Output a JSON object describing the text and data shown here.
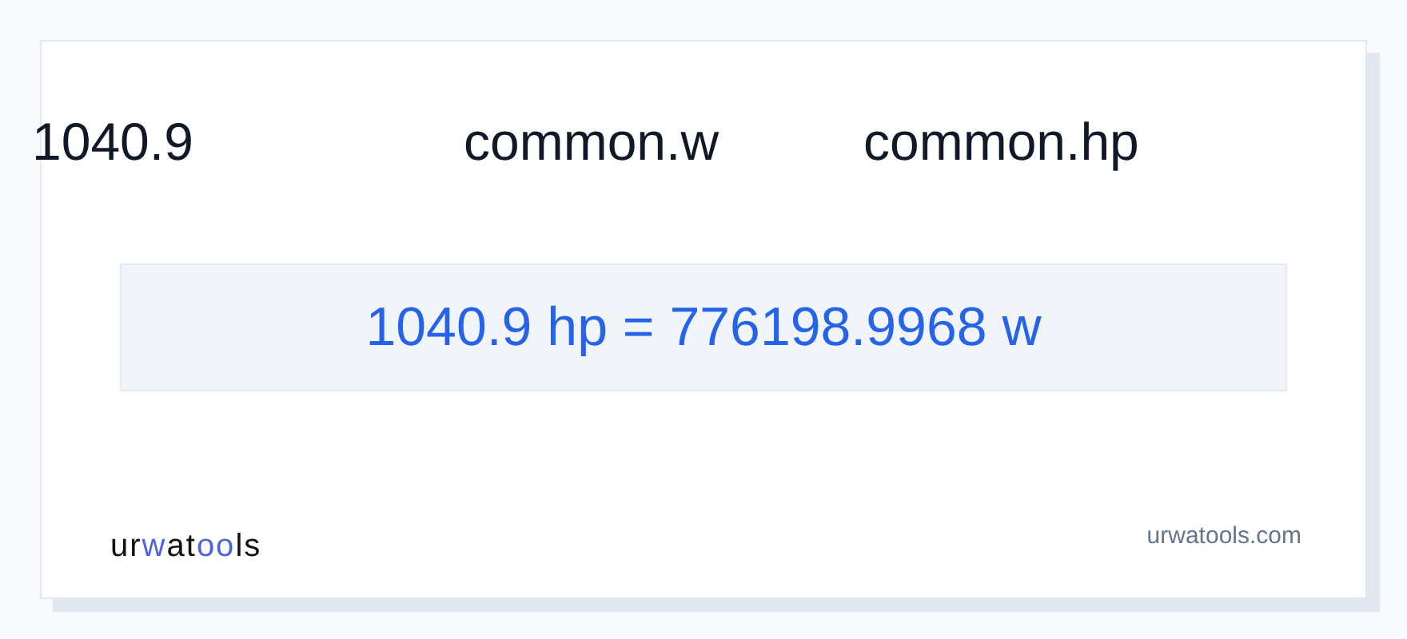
{
  "header": {
    "value": "1040.9",
    "from_unit": "common.w",
    "to_unit": "common.hp"
  },
  "result": "1040.9 hp = 776198.9968 w",
  "logo": [
    {
      "text": "ur",
      "accent": false
    },
    {
      "text": "w",
      "accent": true
    },
    {
      "text": "at",
      "accent": false
    },
    {
      "text": "oo",
      "accent": true
    },
    {
      "text": "ls",
      "accent": false
    }
  ],
  "site": "urwatools.com"
}
